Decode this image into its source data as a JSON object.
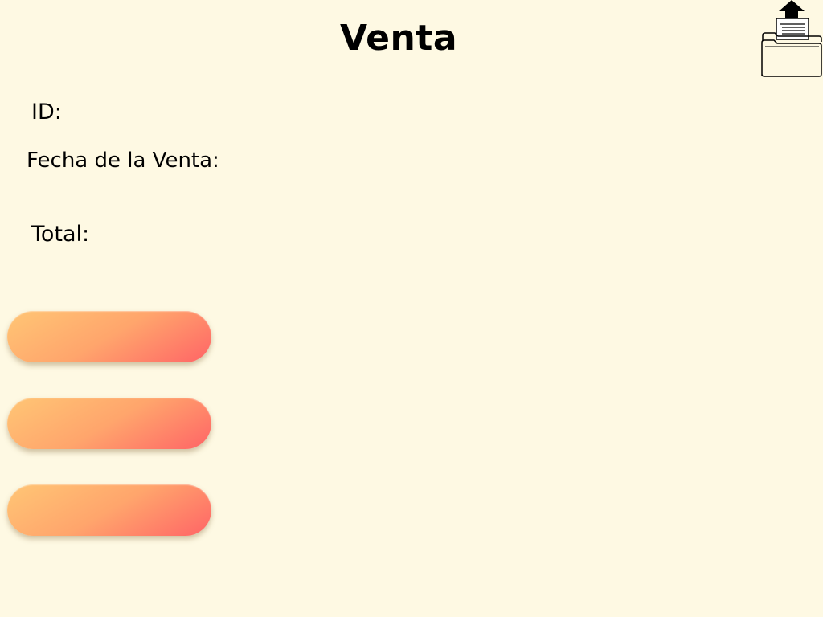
{
  "header": {
    "title": "Venta"
  },
  "toolbar": {
    "export_icon": "folder-upload-icon"
  },
  "form": {
    "id_label": "ID:",
    "date_label": "Fecha de la Venta:",
    "total_label": "Total:"
  },
  "actions": [
    {
      "label": ""
    },
    {
      "label": ""
    },
    {
      "label": ""
    }
  ],
  "colors": {
    "background": "#fef9e3",
    "button_gradient_start": "#ffc675",
    "button_gradient_end": "#ff6466",
    "text": "#000000"
  }
}
